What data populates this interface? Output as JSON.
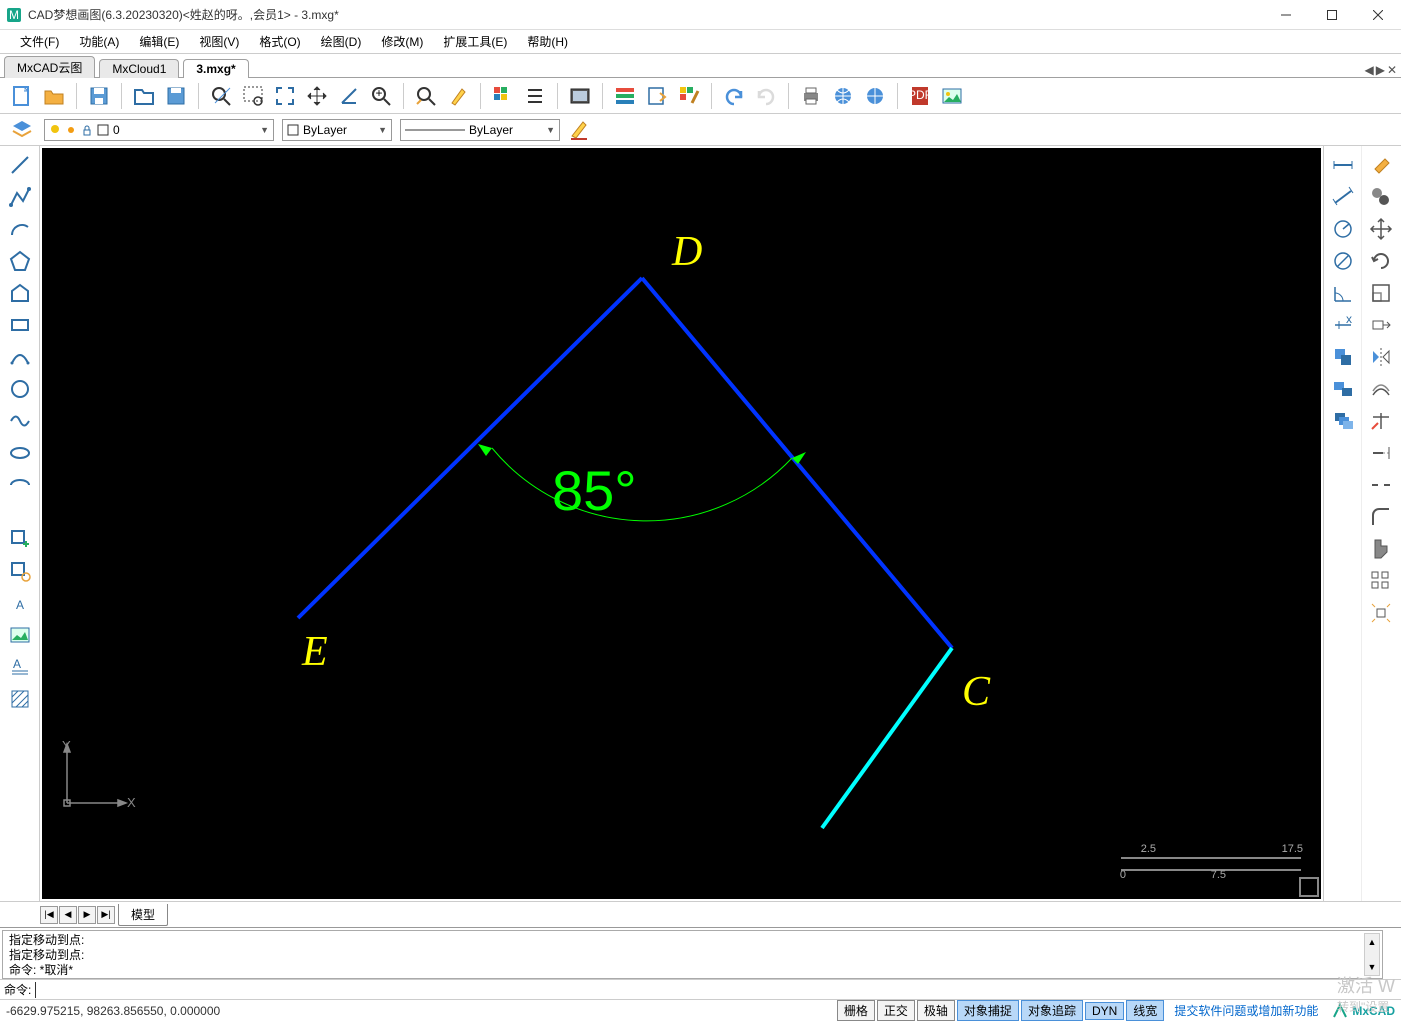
{
  "window": {
    "title": "CAD梦想画图(6.3.20230320)<姓赵的呀。,会员1> - 3.mxg*"
  },
  "menus": [
    "文件(F)",
    "功能(A)",
    "编辑(E)",
    "视图(V)",
    "格式(O)",
    "绘图(D)",
    "修改(M)",
    "扩展工具(E)",
    "帮助(H)"
  ],
  "doc_tabs": [
    {
      "label": "MxCAD云图",
      "active": false
    },
    {
      "label": "MxCloud1",
      "active": false
    },
    {
      "label": "3.mxg*",
      "active": true
    }
  ],
  "layer_row": {
    "current_layer": "0",
    "color_style": "ByLayer",
    "line_style": "ByLayer"
  },
  "model_tab": "模型",
  "command_history": [
    "指定移动到点:",
    "指定移动到点:",
    "命令:    *取消*"
  ],
  "command_prompt": "命令:",
  "statusbar": {
    "coords": "-6629.975215,  98263.856550,  0.000000",
    "toggles": [
      {
        "label": "栅格",
        "active": false
      },
      {
        "label": "正交",
        "active": false
      },
      {
        "label": "极轴",
        "active": false
      },
      {
        "label": "对象捕捉",
        "active": true
      },
      {
        "label": "对象追踪",
        "active": true
      },
      {
        "label": "DYN",
        "active": true
      },
      {
        "label": "线宽",
        "active": true
      }
    ],
    "feedback_link": "提交软件问题或增加新功能",
    "brand": "MxCAD"
  },
  "canvas": {
    "labels": {
      "D": "D",
      "E": "E",
      "C": "C"
    },
    "angle": "85°",
    "axis_x": "X",
    "axis_y": "Y",
    "scale_ticks": [
      "2.5",
      "17.5",
      "0",
      "7.5"
    ]
  },
  "watermark": "激活 W",
  "watermark2": "转到\"设置"
}
